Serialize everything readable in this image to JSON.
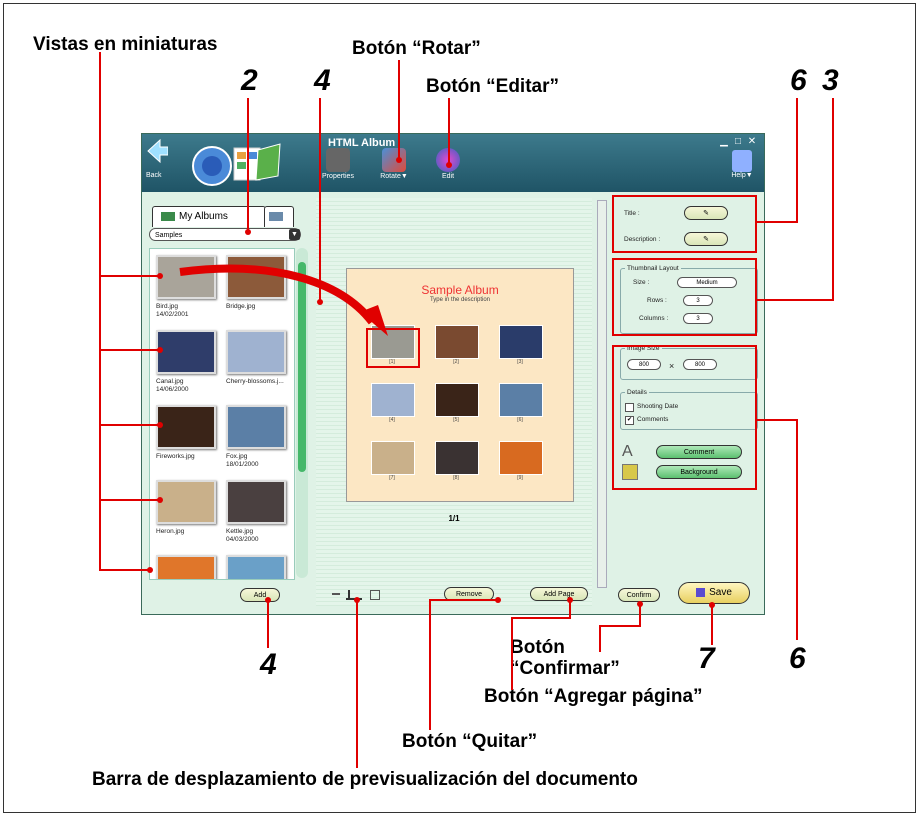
{
  "callouts": {
    "thumbnails": "Vistas en miniaturas",
    "rotate": "Botón “Rotar”",
    "edit": "Botón “Editar”",
    "confirm_line1": "Botón",
    "confirm_line2": "“Confirmar”",
    "add_page": "Botón “Agregar página”",
    "remove": "Botón “Quitar”",
    "scrollbar": "Barra de desplazamiento de previsualización del documento"
  },
  "numbers": {
    "n2": "2",
    "n4_top": "4",
    "n6_top": "6",
    "n3": "3",
    "n4_bottom": "4",
    "n7": "7",
    "n6_bottom": "6"
  },
  "app": {
    "title": "HTML Album",
    "back_label": "Back",
    "toolbar": {
      "properties": "Properties",
      "rotate": "Rotate▼",
      "edit": "Edit",
      "help": "Help▼"
    },
    "tabs": {
      "my_albums": "My Albums"
    },
    "album_select": "Samples",
    "thumbnails": [
      {
        "name": "Bird.jpg",
        "date": "14/02/2001",
        "color": "#a9a49a"
      },
      {
        "name": "Bridge.jpg",
        "date": "",
        "color": "#8c5a3a"
      },
      {
        "name": "Canal.jpg",
        "date": "14/06/2000",
        "color": "#2f3d6a"
      },
      {
        "name": "Cherry-blossoms.j...",
        "date": "",
        "color": "#9fb2d0"
      },
      {
        "name": "Fireworks.jpg",
        "date": "",
        "color": "#3a2418"
      },
      {
        "name": "Fox.jpg",
        "date": "18/01/2000",
        "color": "#5b7fa6"
      },
      {
        "name": "Heron.jpg",
        "date": "",
        "color": "#c9b08a"
      },
      {
        "name": "Kettle.jpg",
        "date": "04/03/2000",
        "color": "#4a4040"
      },
      {
        "name": "",
        "date": "",
        "color": "#e0762a"
      },
      {
        "name": "",
        "date": "",
        "color": "#6aa0c8"
      }
    ],
    "buttons": {
      "add": "Add",
      "remove": "Remove",
      "add_page": "Add Page",
      "confirm": "Confirm",
      "save": "Save"
    },
    "preview": {
      "title": "Sample Album",
      "subtitle": "Type in the description",
      "captions": [
        "[1]",
        "[2]",
        "[3]",
        "[4]",
        "[5]",
        "[6]",
        "[7]",
        "[8]",
        "[9]"
      ],
      "colors": [
        "#9a9a92",
        "#7a4a30",
        "#2a3c6a",
        "#9fb2d0",
        "#3a2418",
        "#5b7fa6",
        "#c9b08a",
        "#3a3232",
        "#d86a20"
      ],
      "page": "1/1"
    },
    "properties": {
      "title_label": "Title :",
      "description_label": "Description :",
      "thumbnail_layout": "Thumbnail Layout",
      "size_label": "Size :",
      "size_value": "Medium",
      "rows_label": "Rows :",
      "rows_value": "3",
      "columns_label": "Columns :",
      "columns_value": "3",
      "image_size": "Image Size",
      "width": "800",
      "height": "800",
      "times": "×",
      "details": "Details",
      "shooting_date": "Shooting Date",
      "comments": "Comments",
      "comment_btn": "Comment",
      "background_btn": "Background"
    }
  },
  "colors": {
    "callout_red": "#e00000",
    "panel_green": "#dff2e6",
    "titlebar": "#1f5466"
  }
}
